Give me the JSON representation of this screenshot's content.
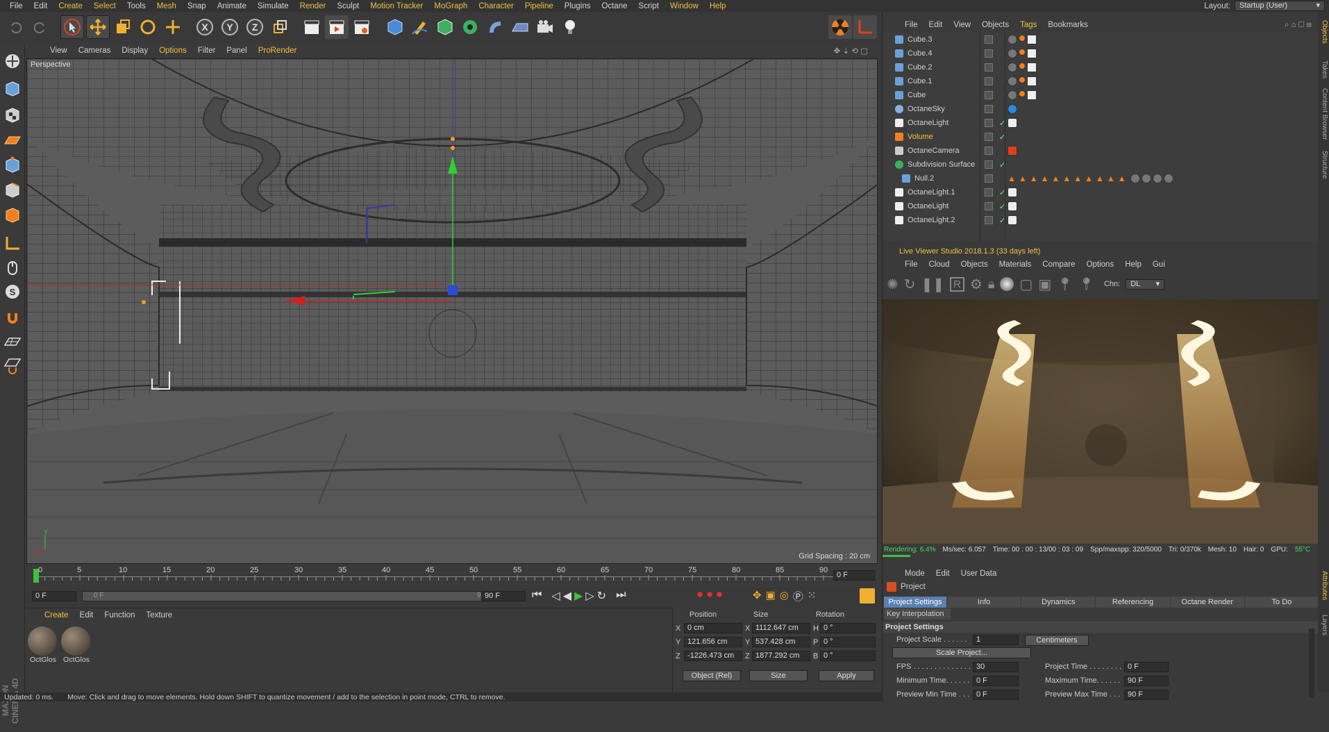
{
  "menu": [
    "File",
    "Edit",
    "Create",
    "Select",
    "Tools",
    "Mesh",
    "Snap",
    "Animate",
    "Simulate",
    "Render",
    "Sculpt",
    "Motion Tracker",
    "MoGraph",
    "Character",
    "Pipeline",
    "Plugins",
    "Octane",
    "Script",
    "Window",
    "Help"
  ],
  "layout": {
    "label": "Layout:",
    "value": "Startup (User)"
  },
  "viewport": {
    "menu": [
      "View",
      "Cameras",
      "Display",
      "Options",
      "Filter",
      "Panel",
      "ProRender"
    ],
    "name": "Perspective",
    "grid_spacing": "Grid Spacing : 20 cm"
  },
  "timeline": {
    "ticks": [
      "0",
      "5",
      "10",
      "15",
      "20",
      "25",
      "30",
      "35",
      "40",
      "45",
      "50",
      "55",
      "60",
      "65",
      "70",
      "75",
      "80",
      "85",
      "90"
    ],
    "frame": "0 F"
  },
  "transport": {
    "start": "0 F",
    "cur": "0 F",
    "end_bar": "90 F",
    "end": "90 F"
  },
  "materials": {
    "menu": [
      "Create",
      "Edit",
      "Function",
      "Texture"
    ],
    "items": [
      "OctGlos",
      "OctGlos"
    ]
  },
  "coords": {
    "headers": [
      "Position",
      "Size",
      "Rotation"
    ],
    "rows": [
      {
        "axis": "X",
        "pos": "0 cm",
        "saxis": "X",
        "size": "1112.647 cm",
        "raxis": "H",
        "rot": "0 °"
      },
      {
        "axis": "Y",
        "pos": "121.656 cm",
        "saxis": "Y",
        "size": "537.428 cm",
        "raxis": "P",
        "rot": "0 °"
      },
      {
        "axis": "Z",
        "pos": "-1226.473 cm",
        "saxis": "Z",
        "size": "1877.292 cm",
        "raxis": "B",
        "rot": "0 °"
      }
    ],
    "mode": "Object (Rel)",
    "size_mode": "Size",
    "apply": "Apply"
  },
  "status": {
    "time": "Updated: 0 ms.",
    "msg": "Move: Click and drag to move elements. Hold down SHIFT to quantize movement / add to the selection in point mode, CTRL to remove."
  },
  "objects": {
    "menu": [
      "File",
      "Edit",
      "View",
      "Objects",
      "Tags",
      "Bookmarks"
    ],
    "items": [
      "Cube.3",
      "Cube.4",
      "Cube.2",
      "Cube.1",
      "Cube",
      "OctaneSky",
      "OctaneLight",
      "Volume",
      "OctaneCamera",
      "Subdivision Surface",
      "Null.2",
      "OctaneLight.1",
      "OctaneLight",
      "OctaneLight.2"
    ]
  },
  "liveviewer": {
    "title": "Live Viewer Studio 2018.1.3 (33 days left)",
    "menu": [
      "File",
      "Cloud",
      "Objects",
      "Materials",
      "Compare",
      "Options",
      "Help",
      "Gui"
    ],
    "chn_label": "Chn:",
    "chn": "DL",
    "status": {
      "rendering": "Rendering: 6.4%",
      "ms": "Ms/sec: 6.057",
      "time": "Time: 00 : 00 : 13/00 : 03 : 09",
      "spp": "Spp/maxspp: 320/5000",
      "tri": "Tri: 0/370k",
      "mesh": "Mesh: 10",
      "hair": "Hair: 0",
      "gpu": "GPU:",
      "temp": "55°C"
    }
  },
  "attributes": {
    "menu": [
      "Mode",
      "Edit",
      "User Data"
    ],
    "title": "Project",
    "tabs": [
      "Project Settings",
      "Info",
      "Dynamics",
      "Referencing",
      "Octane Render",
      "To Do"
    ],
    "sub": "Key Interpolation",
    "section": "Project Settings",
    "scale_label": "Project Scale . . . . . .",
    "scale_val": "1",
    "scale_unit": "Centimeters",
    "scale_btn": "Scale Project...",
    "fps_label": "FPS . . . . . . . . . . . . . .",
    "fps": "30",
    "ptime_label": "Project Time . . . . . . . .",
    "ptime": "0 F",
    "mintime_label": "Minimum Time. . . . . .",
    "mintime": "0 F",
    "maxtime_label": "Maximum Time. . . . . .",
    "maxtime": "90 F",
    "pmin_label": "Preview Min Time . . .",
    "pmin": "0 F",
    "pmax_label": "Preview Max Time . . .",
    "pmax": "90 F"
  },
  "side_tabs": [
    "Objects",
    "Takes",
    "Content Browser",
    "Structure",
    "Attributes",
    "Layers"
  ],
  "brand": "MAXON CINEMA 4D"
}
